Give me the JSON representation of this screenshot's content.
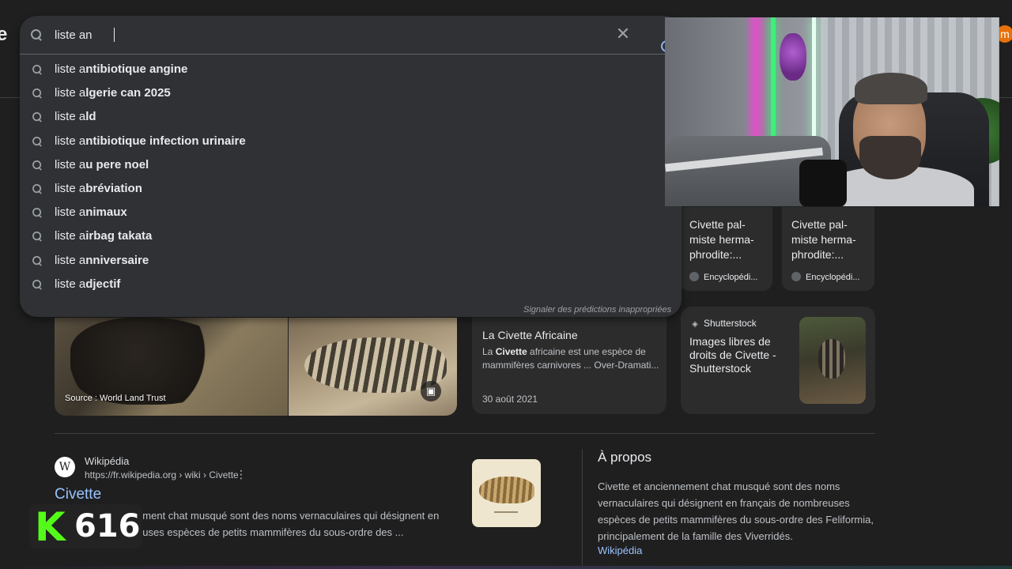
{
  "header": {
    "logo_fragment": "e",
    "avatar_letter": "m"
  },
  "search": {
    "query": "liste an",
    "placeholder": "",
    "clear_icon": "close-icon",
    "submit_icon": "search-icon"
  },
  "suggestions": [
    {
      "prefix": "liste a",
      "completion": "ntibiotique angine"
    },
    {
      "prefix": "liste a",
      "completion": "lgerie can 2025"
    },
    {
      "prefix": "liste a",
      "completion": "ld"
    },
    {
      "prefix": "liste a",
      "completion": "ntibiotique infection urinaire"
    },
    {
      "prefix": "liste a",
      "completion": "u pere noel"
    },
    {
      "prefix": "liste a",
      "completion": "bréviation"
    },
    {
      "prefix": "liste a",
      "completion": "nimaux"
    },
    {
      "prefix": "liste a",
      "completion": "irbag takata"
    },
    {
      "prefix": "liste a",
      "completion": "nniversaire"
    },
    {
      "prefix": "liste a",
      "completion": "djectif"
    }
  ],
  "report_link": "Signaler des prédictions inappropriées",
  "images": {
    "source_caption": "Source : World Land Trust"
  },
  "cards": {
    "africaine": {
      "title": "La Civette Africaine",
      "snippet_pre": "La ",
      "snippet_bold": "Civette",
      "snippet_post": " africaine est une espèce de mammifères carnivores ... Over-Dramati...",
      "date": "30 août 2021"
    },
    "shutterstock": {
      "source": "Shutterstock",
      "title": "Images libres de droits de Civette - Shutterstock"
    },
    "mini": [
      {
        "title": "Civette pal-miste herma-phrodite:...",
        "source": "Encyclopédi..."
      },
      {
        "title": "Civette pal-miste herma-phrodite:...",
        "source": "Encyclopédi..."
      }
    ]
  },
  "result": {
    "site": "Wikipédia",
    "url": "https://fr.wikipedia.org › wiki › Civette",
    "title": "Civette",
    "desc": "Civette et anciennement chat musqué sont des noms vernaculaires qui désignent en français de nombreuses espèces de petits mammifères du sous-ordre des ..."
  },
  "about": {
    "title": "À propos",
    "text": "Civette et anciennement chat musqué sont des noms vernaculaires qui désignent en français de nombreuses espèces de petits mammifères du sous-ordre des Feliformia, principalement de la famille des Viverridés.",
    "link": "Wikipédia"
  },
  "overlay": {
    "badge_letter": "K",
    "badge_count": "616",
    "badge_color": "#53fc18"
  },
  "colors": {
    "background": "#1f1f1f",
    "panel": "#303134",
    "link": "#99c3ff"
  }
}
